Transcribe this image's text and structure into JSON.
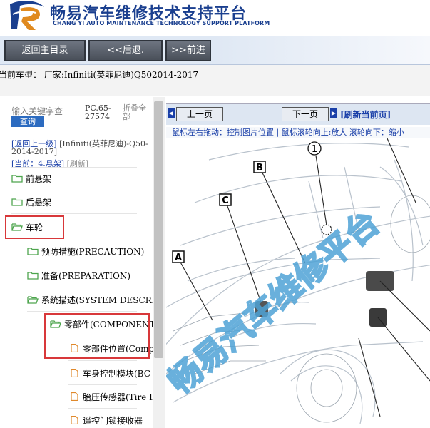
{
  "header": {
    "title": "畅易汽车维修技术支持平台",
    "subtitle": "CHANG YI AUTO MAINTENANCE TECHNOLOGY SUPPORT PLATFORM"
  },
  "nav": {
    "home_label": "返回主目录",
    "back_label": "<<后退.",
    "forward_label": ">>前进"
  },
  "car_info": "当前车型： 厂家:Infiniti(英菲尼迪)Q502014-2017",
  "search": {
    "placeholder": "输入关键字查",
    "button_label": "查询",
    "pc_code": "PC.65-27574",
    "collapse_all": "折叠全部"
  },
  "back_link": {
    "up_label": "[返回上一级]",
    "path": "[Infiniti(英菲尼迪)-Q50-2014-2017]"
  },
  "current": {
    "label": "[当前：4.悬架]",
    "refresh": "[刷新]"
  },
  "tree": [
    {
      "label": "前悬架"
    },
    {
      "label": "后悬架"
    },
    {
      "label": "车轮"
    },
    {
      "label": "预防措施(PRECAUTION)"
    },
    {
      "label": "准备(PREPARATION)"
    },
    {
      "label": "系统描述(SYSTEM DESCRI"
    },
    {
      "label": "零部件(COMPONENT"
    },
    {
      "label": "零部件位置(Comp"
    },
    {
      "label": "车身控制模块(BC"
    },
    {
      "label": "胎压传感器(Tire F"
    },
    {
      "label": "遥控门锁接收器"
    }
  ],
  "pager": {
    "prev_label": "上一页",
    "next_label": "下一页",
    "refresh_label": "[刷新当前页]"
  },
  "hint": "鼠标左右拖动：控制图片位置 | 鼠标滚轮向上:放大  滚轮向下：缩小",
  "diagram": {
    "callouts": [
      "1",
      "B",
      "C",
      "A"
    ],
    "watermark": "畅易汽车维修平台"
  },
  "colors": {
    "brand_blue": "#1a3f8f",
    "highlight_red": "#d8383a",
    "folder_green": "#4da54d",
    "doc_orange": "#e0892b"
  }
}
